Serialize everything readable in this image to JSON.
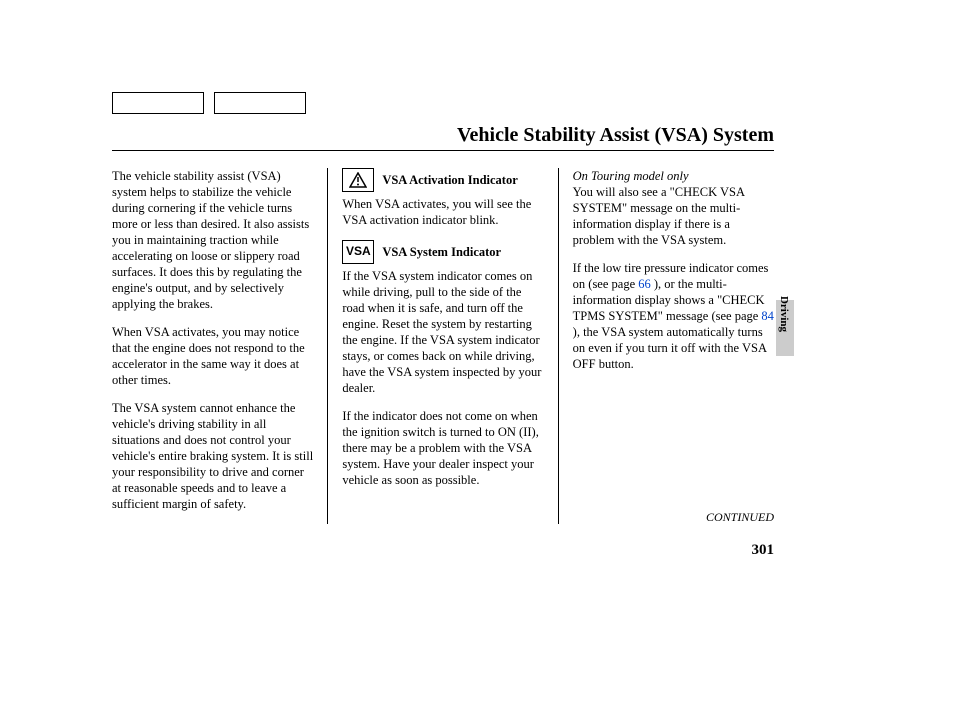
{
  "title": "Vehicle Stability Assist (VSA) System",
  "col1": {
    "p1": "The vehicle stability assist (VSA) system helps to stabilize the vehicle during cornering if the vehicle turns more or less than desired. It also assists you in maintaining traction while accelerating on loose or slippery road surfaces. It does this by regulating the engine's output, and by selectively applying the brakes.",
    "p2": "When VSA activates, you may notice that the engine does not respond to the accelerator in the same way it does at other times.",
    "p3": "The VSA system cannot enhance the vehicle's driving stability in all situations and does not control your vehicle's entire braking system. It is still your responsibility to drive and corner at reasonable speeds and to leave a sufficient margin of safety."
  },
  "col2": {
    "ind1_label": "VSA Activation Indicator",
    "ind1_text": "When VSA activates, you will see the VSA activation indicator blink.",
    "ind2_icon": "VSA",
    "ind2_label": "VSA System Indicator",
    "ind2_text": "If the VSA system indicator comes on while driving, pull to the side of the road when it is safe, and turn off the engine. Reset the system by restarting the engine. If the VSA system indicator stays, or comes back on while driving, have the VSA system inspected by your dealer.",
    "p3": "If the indicator does not come on when the ignition switch is turned to ON (II), there may be a problem with the VSA system. Have your dealer inspect your vehicle as soon as possible."
  },
  "col3": {
    "note": "On Touring model only",
    "p1": "You will also see a \"CHECK VSA SYSTEM\" message on the multi-information display if there is a problem with the VSA system.",
    "p2_a": "If the low tire pressure indicator comes on (see page ",
    "ref1": "66",
    "p2_b": " ), or the multi-information display shows a \"CHECK TPMS SYSTEM\" message (see page ",
    "ref2": "84",
    "p2_c": " ), the VSA system automatically turns on even if you turn it off with the VSA OFF button."
  },
  "continued": "CONTINUED",
  "page_num": "301",
  "side_label": "Driving"
}
